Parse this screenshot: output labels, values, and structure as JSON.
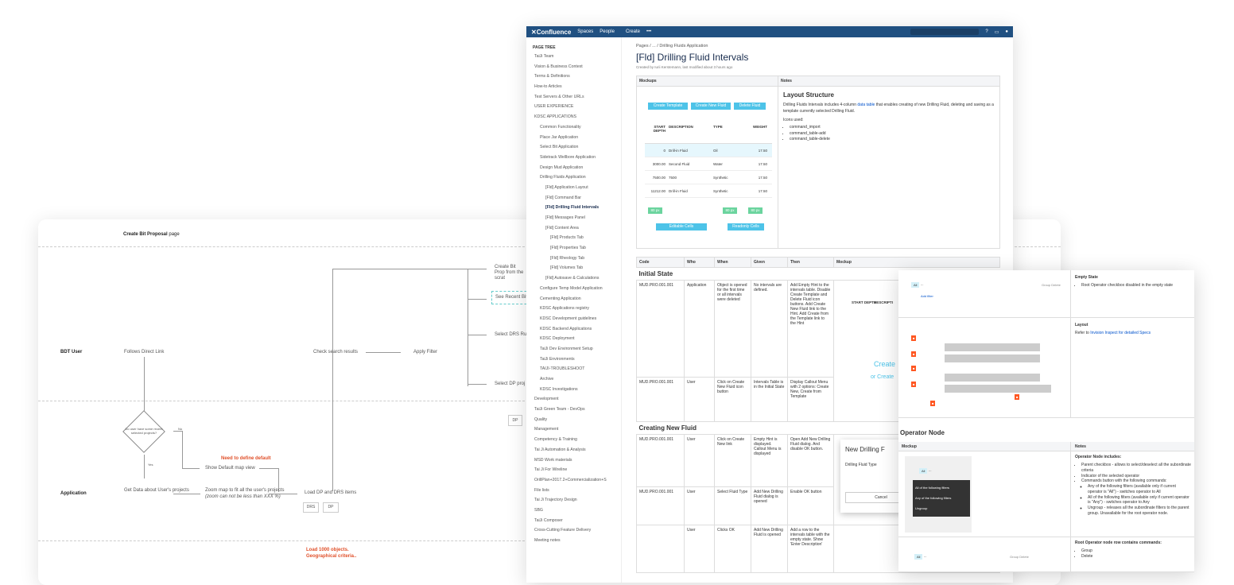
{
  "flow": {
    "title": "Create Bit Proposal",
    "title_suffix": "page",
    "lane_bdt": "BDT User",
    "lane_app": "Application",
    "follows_link": "Follows Direct Link",
    "check_results": "Check search results",
    "apply_filter": "Apply Filter",
    "create_bit": "Create Bit Prop from the scrat",
    "see_recent": "See Recent Bit",
    "select_drs": "Select DRS Ru",
    "select_dp": "Select DP proj",
    "dp_box": "DP",
    "decision": "Do user have some recent selected projects?",
    "no": "No",
    "yes": "Yes",
    "need_define": "Need to define default",
    "show_default": "Show Default map view",
    "get_data": "Get Data about User's projects",
    "zoom_map": "Zoom map to fit all the user's projects",
    "zoom_note": "(zoom can not be less than XXX %)",
    "load_items": "Load DP and DRS items",
    "drs": "DRS",
    "dp": "DP",
    "load_note": "Load 1000 objects. Geographical criteria.."
  },
  "confluence": {
    "logo": "Confluence",
    "nav": [
      "Spaces",
      "People",
      "Create",
      "•••"
    ],
    "page_tree": "PAGE TREE",
    "tree": [
      "TaiJi Team",
      "Vision & Business Context",
      "Terms & Definitions",
      "How-to Articles",
      "Test Servers & Other URLs",
      "USER EXPERIENCE",
      "KDSC APPLICATIONS",
      "Common Functionality",
      "Place Jar Application",
      "Select Bit Application",
      "Sidetrack Wellbore Application",
      "Design Mud Application",
      "Drilling Fluids Application",
      "[Fld] Application Layout",
      "[Fld] Command Bar",
      "[Fld] Drilling Fluid Intervals",
      "[Fld] Messages Panel",
      "[Fld] Content Area",
      "[Fld] Products Tab",
      "[Fld] Properties Tab",
      "[Fld] Rheology Tab",
      "[Fld] Volumes Tab",
      "[Fld] Autosave & Calculations",
      "Configure Temp Model Application",
      "Cementing Application",
      "KDSC Applications registry",
      "KDSC Development guidelines",
      "KDSC Backend Applications",
      "KDSC Deployment",
      "TaiJi Dev Environment Setup",
      "TaiJi Environments",
      "TAIJI-TROUBLESHOOT",
      "Archive",
      "KDSC Investigations",
      "Development",
      "TaiJi Green Team - DevOps",
      "Quality",
      "Management",
      "Competency & Training",
      "Tai Ji Automation & Analysis",
      "MSD Work materials",
      "Tai Ji For Wireline",
      "OrillPlan+2017.2+Commercialization+S",
      "File lists",
      "Tai Ji Trajectory Design",
      "SBG",
      "TaiJi Composer",
      "Cross-Cutting Feature Delivery",
      "Meeting notes"
    ],
    "breadcrumb": "Pages / ... / Drilling Fluids Application",
    "title": "[Fld] Drilling Fluid Intervals",
    "meta": "Created by Iurii Kerstemann, last modified about 3 hours ago",
    "mockups_h": "Mockups",
    "notes_h": "Notes",
    "btns": [
      "Create Template",
      "Create New Fluid",
      "Delete Fluid"
    ],
    "cols": [
      "START DEPTH",
      "DESCRIPTION",
      "TYPE",
      "WEIGHT"
    ],
    "rows": [
      [
        "0",
        "Drill-in Fluid",
        "Oil",
        "17.50"
      ],
      [
        "3000.00",
        "Second Fluid",
        "Water",
        "17.50"
      ],
      [
        "7500.00",
        "7500",
        "Synthetic",
        "17.50"
      ],
      [
        "11212.00",
        "Drill-in Fluid",
        "Synthetic",
        "17.50"
      ]
    ],
    "px1": "80 px",
    "px2": "80 px",
    "px3": "80 px",
    "editable": "Editable Cells",
    "readonly": "Readonly Cells",
    "layout_h": "Layout Structure",
    "layout_p1": "Drilling Fluids Intervals includes 4-column",
    "layout_link": "data table",
    "layout_p2": "that enables creating of new Drilling Fluid, deleting and saving as a template currently selected Drilling Fluid.",
    "icons_used": "Icons used:",
    "icons": [
      "command_import",
      "command_table-add",
      "command_table-delete"
    ],
    "spec_cols": [
      "Code",
      "Who",
      "When",
      "Given",
      "Then",
      "Mockup"
    ],
    "initial": "Initial State",
    "creating": "Creating New Fluid",
    "r1": {
      "code": "MUD.PRO.001.001",
      "who": "Application",
      "when": "Object is opened for the first time or all intervals were deleted",
      "given": "No intervals are defined.",
      "then": "Add Empty Hint to the intervals table. Disable Create Template and Delete Fluid icon buttons. Add Create New Fluid link to the Hint. Add Create from the Template link to the Hint"
    },
    "r2": {
      "code": "MUD.PRO.001.001",
      "who": "User",
      "when": "Click on Create New Fluid icon button",
      "given": "Intervals Table is in the Initial State",
      "then": "Display Callout Menu with 2 options: Create New, Create from Template"
    },
    "r3": {
      "code": "MUD.PRO.001.001",
      "who": "User",
      "when": "Click on Create New link",
      "given": "Empty Hint is displayed. Callout Menu is displayed",
      "then": "Open Add New Drilling Fluid dialog. And disable OK button."
    },
    "r4": {
      "code": "MUD.PRO.001.001",
      "who": "User",
      "when": "Select Fluid Type",
      "given": "Add New Drilling Fluid dialog is opened",
      "then": "Enable OK button"
    },
    "r5": {
      "code": "",
      "who": "User",
      "when": "Clicks OK",
      "given": "Add New Drilling Fluid is opened",
      "then": "Add a row to the intervals table with the empty state. Show 'Enter Description'"
    },
    "mock_start": "START DEPTH",
    "mock_desc": "DESCRIPTI",
    "create_txt": "Create",
    "or_create": "or Create",
    "dialog_title": "New Drilling F",
    "dialog_label": "Drilling Fluid Type",
    "dialog_cancel": "Cancel"
  },
  "overlay": {
    "empty_state": "Empty State",
    "empty_item": "Root Operator checkbox disabled in the empty state",
    "layout": "Layout",
    "layout_ref": "Refer to",
    "layout_link": "Invision Inspect for detailed Specs",
    "operator_node": "Operator Node",
    "mockup": "Mockup",
    "notes": "Notes",
    "includes": "Operator Node includes:",
    "inc_items": [
      "Parent checkbox - allows to select/deselect all the subordinate criteria",
      "Indicator of the selected operator",
      "Commands button with the following commands:"
    ],
    "sub_items": [
      "Any of the following filters (available only if current operator is \"All\") - switches operator to All",
      "All of the following filters (available only if current operator is \"Any\") - switches operator to Any",
      "Ungroup - releases all the subordinate filters to the parent group. Unavailable for the root operator node."
    ],
    "menu": [
      "All of the following filters",
      "Any of the following filters",
      "Ungroup"
    ],
    "all_tag": "All",
    "add_filter": "Add filter",
    "group": "Group",
    "delete": "Delete",
    "root_cmds": "Root Operator node row contains commands:",
    "root_items": [
      "Group",
      "Delete"
    ]
  }
}
